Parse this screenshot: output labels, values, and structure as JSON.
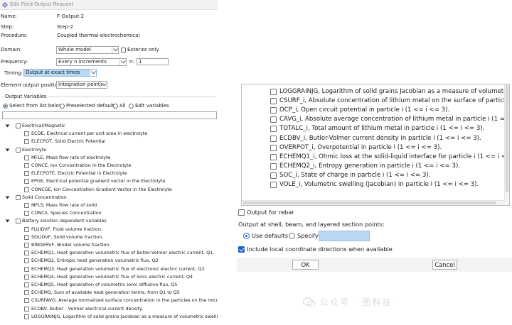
{
  "window": {
    "title": "Edit Field Output Request"
  },
  "info": {
    "name_label": "Name:",
    "name_value": "F-Output-2",
    "step_label": "Step:",
    "step_value": "Step-2",
    "procedure_label": "Procedure:",
    "procedure_value": "Coupled thermal-electrochemical"
  },
  "domain": {
    "label": "Domain:",
    "value": "Whole model",
    "exterior_label": "Exterior only"
  },
  "frequency": {
    "label": "Frequency:",
    "value": "Every n increments",
    "n_label": "n:",
    "n_value": "1"
  },
  "timing": {
    "label": "Timing:",
    "value": "Output at exact times"
  },
  "element_output": {
    "label": "Element output position:",
    "value": "Integration points"
  },
  "output_vars": {
    "heading": "Output Variables",
    "opt_select": "Select from list below",
    "opt_preselected": "Preselected defaults",
    "opt_all": "All",
    "opt_edit": "Edit variables"
  },
  "tree": [
    {
      "type": "group",
      "label": "Electrical/Magnetic"
    },
    {
      "type": "item",
      "label": "ECDE, Electrical current per unit area in electrolyte"
    },
    {
      "type": "item",
      "label": "ELECPOT, Solid Electric Potential"
    },
    {
      "type": "group",
      "label": "Electrolyte"
    },
    {
      "type": "item",
      "label": "MFLE, Mass flow rate of electrolyte"
    },
    {
      "type": "item",
      "label": "CONCE, Ion Concentration in the Electrolyte"
    },
    {
      "type": "item",
      "label": "ELECPOTE, Electric Potential in Electrolyte"
    },
    {
      "type": "item",
      "label": "EPGE, Electrical potential gradient vector in the Electrolyte"
    },
    {
      "type": "item",
      "label": "CONCGE, Ion Concentration Gradient Vector in the Electrolyte"
    },
    {
      "type": "group",
      "label": "Solid Concentration"
    },
    {
      "type": "item",
      "label": "MFLS, Mass flow rate of solid"
    },
    {
      "type": "item",
      "label": "CONCS, Species Concentration"
    },
    {
      "type": "group",
      "label": "Battery solution dependent variables"
    },
    {
      "type": "item",
      "label": "FLUIDVF, Fluid volume fraction."
    },
    {
      "type": "item",
      "label": "SOLIDVF, Solid volume fraction."
    },
    {
      "type": "item",
      "label": "BINDERVF, Binder volume fraction."
    },
    {
      "type": "item",
      "label": "ECHEMQ1, Heat generation volumetric flux of Butler-Volmer electric current, Q1."
    },
    {
      "type": "item",
      "label": "ECHEMQ2, Entropic heat generation volumetric flux, Q2"
    },
    {
      "type": "item",
      "label": "ECHEMQ3, Heat generation volumetric flux of electronic electric current, Q3"
    },
    {
      "type": "item",
      "label": "ECHEMQ4, Heat generation volumetric flux of ionic electric current, Q4"
    },
    {
      "type": "item",
      "label": "ECHEMQ5, Heat generation of volumetric ionic diffusive flux, Q5"
    },
    {
      "type": "item",
      "label": "ECHEMQ, Sum of available heat generation terms, from Q1 to Q5"
    },
    {
      "type": "item",
      "label": "CSURFAVG, Average normalized surface concentration in the particles on the microsc"
    },
    {
      "type": "item",
      "label": "ECDBV, Butler - Volmer electrical current density."
    },
    {
      "type": "item",
      "label": "LOGGRAINJG, Logarithm of solid grains Jacobian as a measure of volumetric swelling."
    }
  ],
  "particle_list": [
    "LOGGRAINJG, Logarithm of solid grains Jacobian as a measure of volumetric swelling.",
    "CSURF_i, Absolute concentration of lithium metal on the surface of particle i (1 <= i <= 3).",
    "OCP_i, Open circuit potential in particle i (1 <= i <= 3).",
    "CAVG_i, Absolute average concentration of lithium metal in particle i (1 = i = 3) for the",
    "TOTALC_i, Total amount of lithium metal in particle i (1 <= i <= 3).",
    "ECDBV_i, Butler-Volmer current density in particle i (1 <= i <= 3).",
    "OVERPOT_i, Overpotential in particle i (1 <= i <= 3).",
    "ECHEMQ1_i, Ohmic loss at the solid-liquid interface for particle i (1 <= i <= 3).",
    "ECHEMQ2_i, Entropy generation in particle i (1 <= i <= 3).",
    "SOC_i, State of charge in particle i (1 <= i <= 3).",
    "VOLE_i, Volumetric swelling (Jacobian) in particle i (1 <= i <= 3)."
  ],
  "rebar": {
    "label": "Output for rebar"
  },
  "section_points": {
    "label": "Output at shell, beam, and layered section points:",
    "opt_defaults": "Use defaults",
    "opt_specify": "Specify:",
    "specify_value": ""
  },
  "local_coords": {
    "label": "Include local coordinate directions when available"
  },
  "buttons": {
    "ok": "OK",
    "cancel": "Cancel"
  },
  "watermark": {
    "text": "公众号 · 图科技 ·"
  },
  "colors": {
    "accent": "#1f64c4",
    "highlight": "#b9d9f7"
  }
}
